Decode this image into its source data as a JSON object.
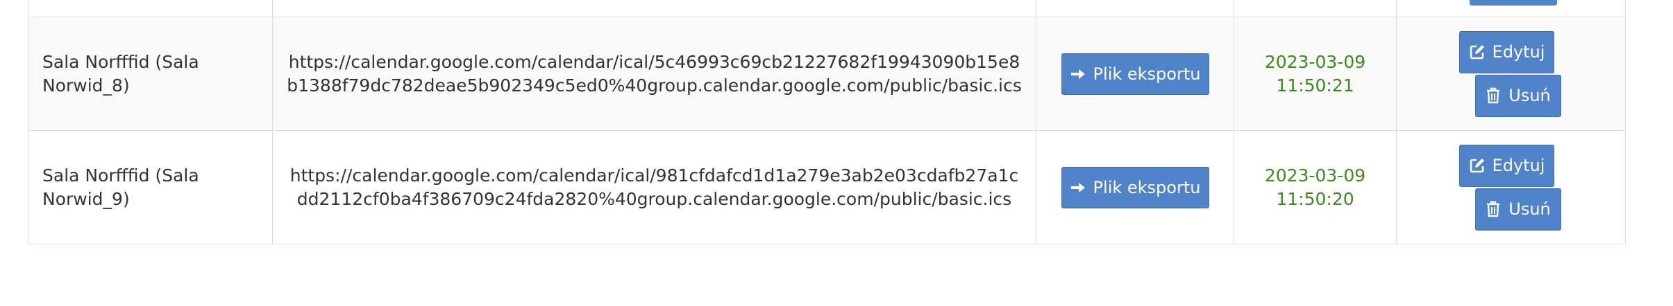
{
  "rows": [
    {
      "name": "Sala Norfffid (Sala Norwid_8)",
      "url": "https://calendar.google.com/calendar/ical/5c46993c69cb21227682f19943090b15e8b1388f79dc782deae5b902349c5ed0%40group.calendar.google.com/public/basic.ics",
      "export_label": "Plik eksportu",
      "date": "2023-03-09",
      "time": "11:50:21",
      "edit_label": "Edytuj",
      "delete_label": "Usuń"
    },
    {
      "name": "Sala Norfffid (Sala Norwid_9)",
      "url": "https://calendar.google.com/calendar/ical/981cfdafcd1d1a279e3ab2e03cdafb27a1cdd2112cf0ba4f386709c24fda2820%40group.calendar.google.com/public/basic.ics",
      "export_label": "Plik eksportu",
      "date": "2023-03-09",
      "time": "11:50:20",
      "edit_label": "Edytuj",
      "delete_label": "Usuń"
    }
  ],
  "colors": {
    "button": "#5083c9",
    "date_text": "#3c8a1c",
    "row_odd_bg": "#f9f9f9",
    "border": "#dddddd"
  },
  "icons": {
    "export": "arrow-right-icon",
    "edit": "edit-icon",
    "delete": "trash-icon"
  }
}
